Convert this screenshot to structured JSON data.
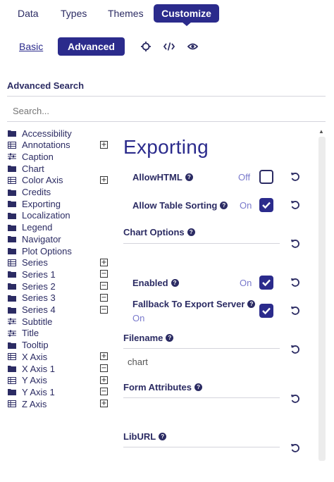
{
  "tabs": [
    {
      "label": "Data"
    },
    {
      "label": "Types"
    },
    {
      "label": "Themes"
    },
    {
      "label": "Customize"
    }
  ],
  "mode": {
    "basic": "Basic",
    "advanced": "Advanced"
  },
  "toolbar_icons": [
    "crosshair-icon",
    "code-icon",
    "eye-icon"
  ],
  "advanced_search": {
    "title": "Advanced Search",
    "placeholder": "Search..."
  },
  "tree": [
    {
      "label": "Accessibility",
      "icon": "folder-icon"
    },
    {
      "label": "Annotations",
      "icon": "table-icon",
      "toggle": "+"
    },
    {
      "label": "Caption",
      "icon": "sliders-icon"
    },
    {
      "label": "Chart",
      "icon": "folder-icon"
    },
    {
      "label": "Color Axis",
      "icon": "table-icon",
      "toggle": "+"
    },
    {
      "label": "Credits",
      "icon": "folder-icon"
    },
    {
      "label": "Exporting",
      "icon": "folder-icon"
    },
    {
      "label": "Localization",
      "icon": "folder-icon"
    },
    {
      "label": "Legend",
      "icon": "folder-icon"
    },
    {
      "label": "Navigator",
      "icon": "folder-icon"
    },
    {
      "label": "Plot Options",
      "icon": "folder-icon"
    },
    {
      "label": "Series",
      "icon": "table-icon",
      "toggle": "+"
    },
    {
      "label": "Series 1",
      "icon": "folder-icon",
      "toggle": "−"
    },
    {
      "label": "Series 2",
      "icon": "folder-icon",
      "toggle": "−"
    },
    {
      "label": "Series 3",
      "icon": "folder-icon",
      "toggle": "−"
    },
    {
      "label": "Series 4",
      "icon": "folder-icon",
      "toggle": "−"
    },
    {
      "label": "Subtitle",
      "icon": "sliders-icon"
    },
    {
      "label": "Title",
      "icon": "sliders-icon"
    },
    {
      "label": "Tooltip",
      "icon": "folder-icon"
    },
    {
      "label": "X Axis",
      "icon": "table-icon",
      "toggle": "+"
    },
    {
      "label": "X Axis 1",
      "icon": "folder-icon",
      "toggle": "−"
    },
    {
      "label": "Y Axis",
      "icon": "table-icon",
      "toggle": "+"
    },
    {
      "label": "Y Axis 1",
      "icon": "folder-icon",
      "toggle": "−"
    },
    {
      "label": "Z Axis",
      "icon": "table-icon",
      "toggle": "+"
    }
  ],
  "panel": {
    "title": "Exporting",
    "allow_html": {
      "label": "AllowHTML",
      "state": "Off"
    },
    "allow_table_sorting": {
      "label": "Allow Table Sorting",
      "state": "On"
    },
    "chart_options": {
      "label": "Chart Options"
    },
    "enabled": {
      "label": "Enabled",
      "state": "On"
    },
    "fallback": {
      "label": "Fallback To Export Server",
      "state": "On"
    },
    "filename": {
      "label": "Filename",
      "value": "chart"
    },
    "form_attributes": {
      "label": "Form Attributes"
    },
    "lib_url": {
      "label": "LibURL"
    }
  },
  "colors": {
    "accent": "#2b2b8c",
    "text": "#2b2b63",
    "state": "#7a7acc"
  }
}
